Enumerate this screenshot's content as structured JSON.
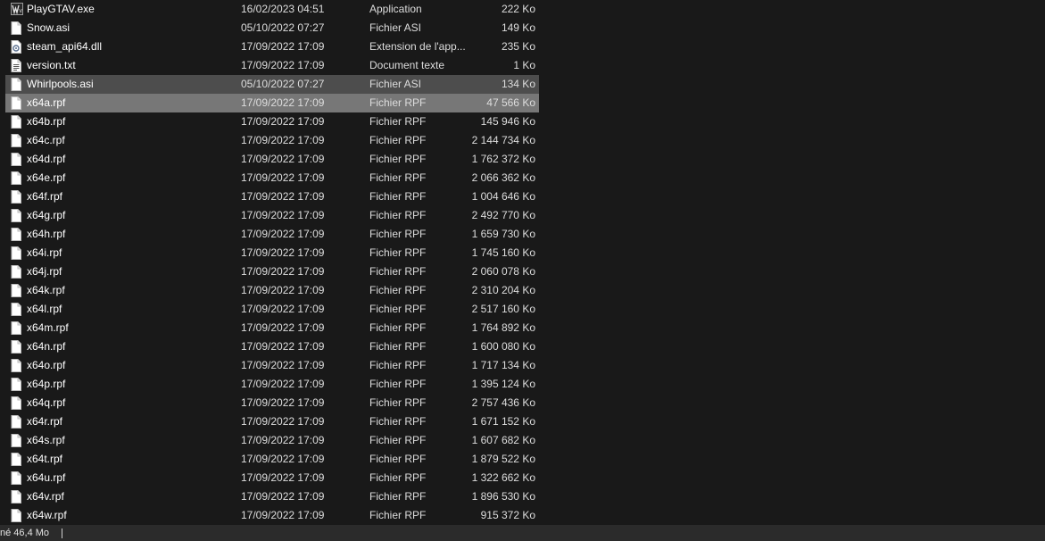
{
  "files": [
    {
      "name": "PlayGTAV.exe",
      "date": "16/02/2023 04:51",
      "type": "Application",
      "size": "222 Ko",
      "icon": "gtav-app-icon",
      "state": "normal"
    },
    {
      "name": "Snow.asi",
      "date": "05/10/2022 07:27",
      "type": "Fichier ASI",
      "size": "149 Ko",
      "icon": "file-icon",
      "state": "normal"
    },
    {
      "name": "steam_api64.dll",
      "date": "17/09/2022 17:09",
      "type": "Extension de l'app...",
      "size": "235 Ko",
      "icon": "dll-gear-icon",
      "state": "normal"
    },
    {
      "name": "version.txt",
      "date": "17/09/2022 17:09",
      "type": "Document texte",
      "size": "1 Ko",
      "icon": "text-file-icon",
      "state": "normal"
    },
    {
      "name": "Whirlpools.asi",
      "date": "05/10/2022 07:27",
      "type": "Fichier ASI",
      "size": "134 Ko",
      "icon": "file-icon",
      "state": "selected"
    },
    {
      "name": "x64a.rpf",
      "date": "17/09/2022 17:09",
      "type": "Fichier RPF",
      "size": "47 566 Ko",
      "icon": "file-icon",
      "state": "hover"
    },
    {
      "name": "x64b.rpf",
      "date": "17/09/2022 17:09",
      "type": "Fichier RPF",
      "size": "145 946 Ko",
      "icon": "file-icon",
      "state": "normal"
    },
    {
      "name": "x64c.rpf",
      "date": "17/09/2022 17:09",
      "type": "Fichier RPF",
      "size": "2 144 734 Ko",
      "icon": "file-icon",
      "state": "normal"
    },
    {
      "name": "x64d.rpf",
      "date": "17/09/2022 17:09",
      "type": "Fichier RPF",
      "size": "1 762 372 Ko",
      "icon": "file-icon",
      "state": "normal"
    },
    {
      "name": "x64e.rpf",
      "date": "17/09/2022 17:09",
      "type": "Fichier RPF",
      "size": "2 066 362 Ko",
      "icon": "file-icon",
      "state": "normal"
    },
    {
      "name": "x64f.rpf",
      "date": "17/09/2022 17:09",
      "type": "Fichier RPF",
      "size": "1 004 646 Ko",
      "icon": "file-icon",
      "state": "normal"
    },
    {
      "name": "x64g.rpf",
      "date": "17/09/2022 17:09",
      "type": "Fichier RPF",
      "size": "2 492 770 Ko",
      "icon": "file-icon",
      "state": "normal"
    },
    {
      "name": "x64h.rpf",
      "date": "17/09/2022 17:09",
      "type": "Fichier RPF",
      "size": "1 659 730 Ko",
      "icon": "file-icon",
      "state": "normal"
    },
    {
      "name": "x64i.rpf",
      "date": "17/09/2022 17:09",
      "type": "Fichier RPF",
      "size": "1 745 160 Ko",
      "icon": "file-icon",
      "state": "normal"
    },
    {
      "name": "x64j.rpf",
      "date": "17/09/2022 17:09",
      "type": "Fichier RPF",
      "size": "2 060 078 Ko",
      "icon": "file-icon",
      "state": "normal"
    },
    {
      "name": "x64k.rpf",
      "date": "17/09/2022 17:09",
      "type": "Fichier RPF",
      "size": "2 310 204 Ko",
      "icon": "file-icon",
      "state": "normal"
    },
    {
      "name": "x64l.rpf",
      "date": "17/09/2022 17:09",
      "type": "Fichier RPF",
      "size": "2 517 160 Ko",
      "icon": "file-icon",
      "state": "normal"
    },
    {
      "name": "x64m.rpf",
      "date": "17/09/2022 17:09",
      "type": "Fichier RPF",
      "size": "1 764 892 Ko",
      "icon": "file-icon",
      "state": "normal"
    },
    {
      "name": "x64n.rpf",
      "date": "17/09/2022 17:09",
      "type": "Fichier RPF",
      "size": "1 600 080 Ko",
      "icon": "file-icon",
      "state": "normal"
    },
    {
      "name": "x64o.rpf",
      "date": "17/09/2022 17:09",
      "type": "Fichier RPF",
      "size": "1 717 134 Ko",
      "icon": "file-icon",
      "state": "normal"
    },
    {
      "name": "x64p.rpf",
      "date": "17/09/2022 17:09",
      "type": "Fichier RPF",
      "size": "1 395 124 Ko",
      "icon": "file-icon",
      "state": "normal"
    },
    {
      "name": "x64q.rpf",
      "date": "17/09/2022 17:09",
      "type": "Fichier RPF",
      "size": "2 757 436 Ko",
      "icon": "file-icon",
      "state": "normal"
    },
    {
      "name": "x64r.rpf",
      "date": "17/09/2022 17:09",
      "type": "Fichier RPF",
      "size": "1 671 152 Ko",
      "icon": "file-icon",
      "state": "normal"
    },
    {
      "name": "x64s.rpf",
      "date": "17/09/2022 17:09",
      "type": "Fichier RPF",
      "size": "1 607 682 Ko",
      "icon": "file-icon",
      "state": "normal"
    },
    {
      "name": "x64t.rpf",
      "date": "17/09/2022 17:09",
      "type": "Fichier RPF",
      "size": "1 879 522 Ko",
      "icon": "file-icon",
      "state": "normal"
    },
    {
      "name": "x64u.rpf",
      "date": "17/09/2022 17:09",
      "type": "Fichier RPF",
      "size": "1 322 662 Ko",
      "icon": "file-icon",
      "state": "normal"
    },
    {
      "name": "x64v.rpf",
      "date": "17/09/2022 17:09",
      "type": "Fichier RPF",
      "size": "1 896 530 Ko",
      "icon": "file-icon",
      "state": "normal"
    },
    {
      "name": "x64w.rpf",
      "date": "17/09/2022 17:09",
      "type": "Fichier RPF",
      "size": "915 372 Ko",
      "icon": "file-icon",
      "state": "normal"
    }
  ],
  "status_bar": {
    "text": "né  46,4 Mo"
  },
  "colors": {
    "background": "#191919",
    "selected_row": "#4d4d4d",
    "hover_row": "#777777",
    "status_bar": "#2b2b2b"
  }
}
